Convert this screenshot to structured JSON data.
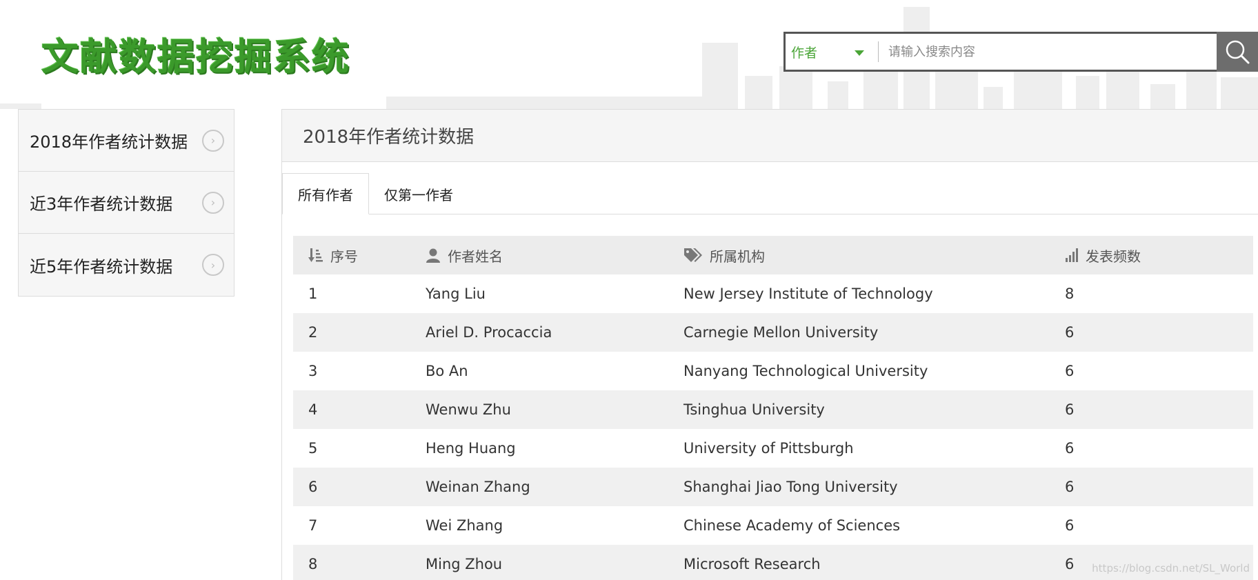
{
  "header": {
    "logo_text": "文献数据挖掘系统",
    "search": {
      "type_selected": "作者",
      "placeholder": "请输入搜索内容",
      "value": ""
    }
  },
  "sidebar": {
    "items": [
      {
        "label": "2018年作者统计数据"
      },
      {
        "label": "近3年作者统计数据"
      },
      {
        "label": "近5年作者统计数据"
      }
    ]
  },
  "main": {
    "title": "2018年作者统计数据",
    "tabs": [
      {
        "label": "所有作者",
        "active": true
      },
      {
        "label": "仅第一作者",
        "active": false
      }
    ],
    "table": {
      "headers": {
        "index": "序号",
        "name": "作者姓名",
        "institution": "所属机构",
        "frequency": "发表频数"
      },
      "header_icons": [
        "sort-icon",
        "user-icon",
        "tag-icon",
        "bar-chart-icon"
      ],
      "rows": [
        {
          "index": "1",
          "name": "Yang Liu",
          "institution": "New Jersey Institute of Technology",
          "frequency": "8"
        },
        {
          "index": "2",
          "name": "Ariel D. Procaccia",
          "institution": "Carnegie Mellon University",
          "frequency": "6"
        },
        {
          "index": "3",
          "name": "Bo An",
          "institution": "Nanyang Technological University",
          "frequency": "6"
        },
        {
          "index": "4",
          "name": "Wenwu Zhu",
          "institution": "Tsinghua University",
          "frequency": "6"
        },
        {
          "index": "5",
          "name": "Heng Huang",
          "institution": "University of Pittsburgh",
          "frequency": "6"
        },
        {
          "index": "6",
          "name": "Weinan Zhang",
          "institution": "Shanghai Jiao Tong University",
          "frequency": "6"
        },
        {
          "index": "7",
          "name": "Wei Zhang",
          "institution": "Chinese Academy of Sciences",
          "frequency": "6"
        },
        {
          "index": "8",
          "name": "Ming Zhou",
          "institution": "Microsoft Research",
          "frequency": "6"
        }
      ]
    }
  },
  "watermark": "https://blog.csdn.net/SL_World",
  "colors": {
    "brand_green": "#3b9a2b",
    "accent_green": "#4aa537",
    "search_button": "#6d6d6d"
  }
}
